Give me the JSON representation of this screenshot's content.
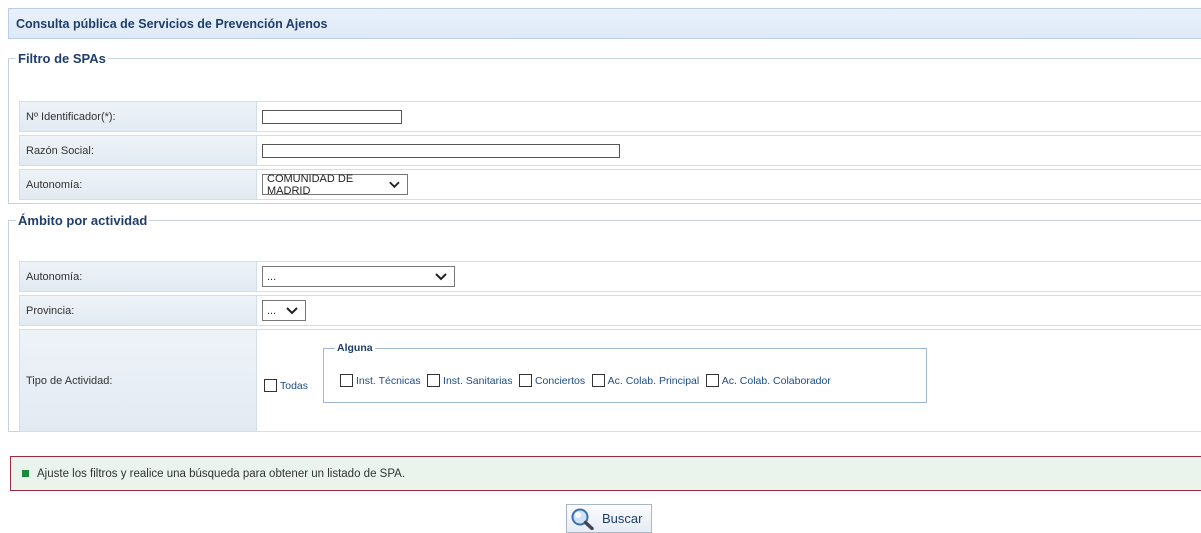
{
  "header": {
    "title": "Consulta pública de Servicios de Prevención Ajenos"
  },
  "filtro": {
    "legend": "Filtro de SPAs",
    "identificador_label": "Nº Identificador(*):",
    "identificador_value": "",
    "razon_label": "Razón Social:",
    "razon_value": "",
    "autonomia_label": "Autonomía:",
    "autonomia_selected": "COMUNIDAD DE MADRID"
  },
  "ambito": {
    "legend": "Ámbito por actividad",
    "autonomia_label": "Autonomía:",
    "autonomia_selected": "...",
    "provincia_label": "Provincia:",
    "provincia_selected": "...",
    "tipo_label": "Tipo de Actividad:",
    "todas_label": "Todas",
    "alguna_legend": "Alguna",
    "options": [
      "Inst. Técnicas",
      "Inst. Sanitarias",
      "Conciertos",
      "Ac. Colab. Principal",
      "Ac. Colab. Colaborador"
    ]
  },
  "message": {
    "text": "Ajuste los filtros y realice una búsqueda para obtener un listado de SPA."
  },
  "actions": {
    "buscar_label": "Buscar"
  },
  "icons": {
    "dropdown": "chevron-down-icon",
    "search": "magnifier-icon",
    "bullet": "green-square-icon"
  },
  "colors": {
    "title_text": "#1f3e6b",
    "link_text": "#1a4d86",
    "message_border": "#9b2b44",
    "message_bg": "#eaf4ec",
    "bullet": "#1c8a3a"
  }
}
